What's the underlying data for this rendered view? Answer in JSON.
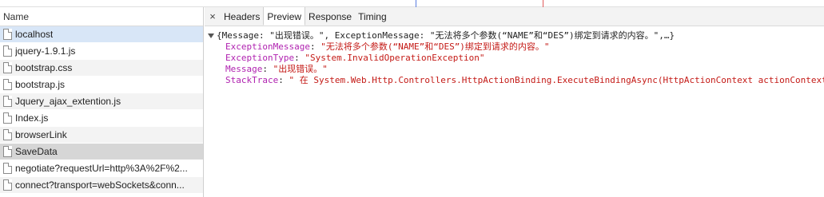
{
  "requests": {
    "header": "Name",
    "items": [
      {
        "name": "localhost"
      },
      {
        "name": "jquery-1.9.1.js"
      },
      {
        "name": "bootstrap.css"
      },
      {
        "name": "bootstrap.js"
      },
      {
        "name": "Jquery_ajax_extention.js"
      },
      {
        "name": "Index.js"
      },
      {
        "name": "browserLink"
      },
      {
        "name": "SaveData"
      },
      {
        "name": "negotiate?requestUrl=http%3A%2F%2..."
      },
      {
        "name": "connect?transport=webSockets&conn..."
      }
    ]
  },
  "details": {
    "close_glyph": "×",
    "tabs": [
      {
        "label": "Headers"
      },
      {
        "label": "Preview"
      },
      {
        "label": "Response"
      },
      {
        "label": "Timing"
      }
    ],
    "active_tab": "Preview"
  },
  "preview": {
    "summary": "{Message: \"出现错误。\", ExceptionMessage: \"无法将多个参数(“NAME”和“DES”)绑定到请求的内容。\",…}",
    "fields": [
      {
        "key": "ExceptionMessage",
        "value": "\"无法将多个参数(“NAME”和“DES”)绑定到请求的内容。\""
      },
      {
        "key": "ExceptionType",
        "value": "\"System.InvalidOperationException\""
      },
      {
        "key": "Message",
        "value": "\"出现错误。\""
      },
      {
        "key": "StackTrace",
        "value": "\" 在 System.Web.Http.Controllers.HttpActionBinding.ExecuteBindingAsync(HttpActionContext actionContext"
      }
    ]
  },
  "colors": {
    "selected_row": "#d8e6f7",
    "json_key": "#b022b0",
    "json_string": "#c41a16"
  }
}
